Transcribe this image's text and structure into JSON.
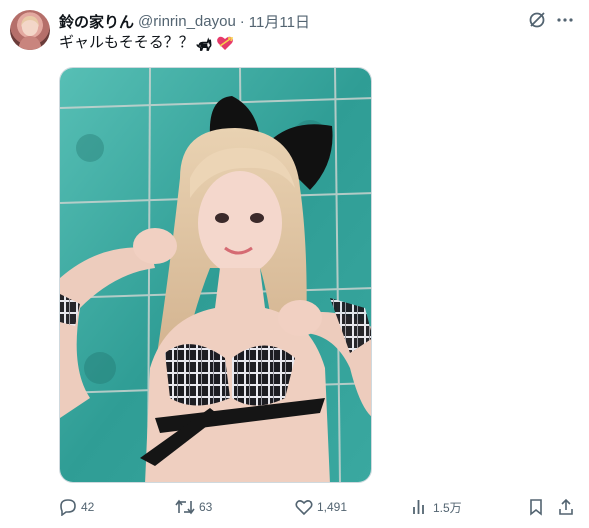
{
  "tweet": {
    "display_name": "鈴の家りん",
    "handle": "@rinrin_dayou",
    "separator": "·",
    "date": "11月11日",
    "text": "ギャルもそそる？？",
    "emojis": [
      "black-cat-emoji",
      "heart-with-ribbon-emoji"
    ]
  },
  "top_icons": [
    "grok-icon",
    "more-icon"
  ],
  "actions": {
    "reply_count": "42",
    "retweet_count": "63",
    "like_count": "1,491",
    "view_count": "1.5万"
  },
  "colors": {
    "text": "#0f1419",
    "secondary": "#536471",
    "tile_green": "#3ea7a0",
    "border": "#cfd9de"
  }
}
